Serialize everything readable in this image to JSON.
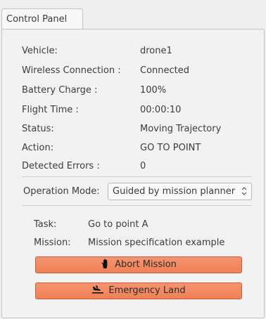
{
  "tab": {
    "label": "Control Panel"
  },
  "status": [
    {
      "label": "Vehicle:",
      "value": "drone1"
    },
    {
      "label": "Wireless Connection :",
      "value": "Connected"
    },
    {
      "label": "Battery Charge :",
      "value": "100%"
    },
    {
      "label": "Flight Time :",
      "value": "00:00:10"
    },
    {
      "label": "Status:",
      "value": "Moving Trajectory"
    },
    {
      "label": "Action:",
      "value": "GO TO POINT"
    },
    {
      "label": "Detected Errors :",
      "value": "0"
    }
  ],
  "operation_mode": {
    "label": "Operation Mode:",
    "selected": "Guided by mission planner"
  },
  "task": {
    "label": "Task:",
    "value": "Go to point A"
  },
  "mission": {
    "label": "Mission:",
    "value": "Mission specification example"
  },
  "buttons": {
    "abort": {
      "label": "Abort Mission",
      "icon": "hand-stop-icon"
    },
    "emergency": {
      "label": "Emergency Land",
      "icon": "landing-icon"
    }
  },
  "colors": {
    "button_fill": "#ef8156",
    "button_border": "#c85f35",
    "background": "#efefef"
  }
}
